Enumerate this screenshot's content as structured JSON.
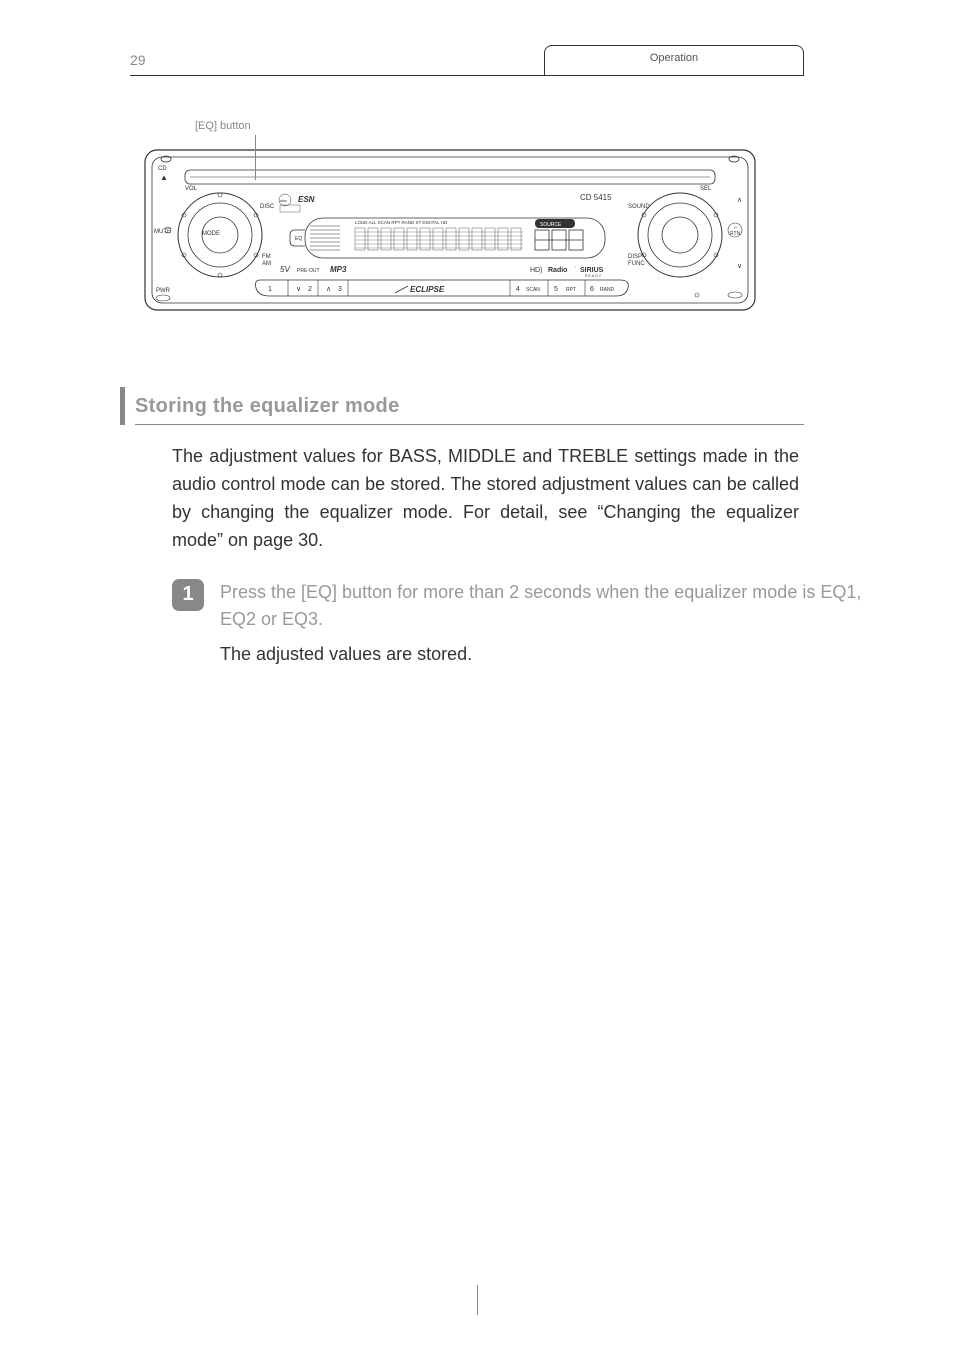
{
  "header": {
    "tab_label": "Operation",
    "page_number": "29"
  },
  "diagram": {
    "callout": "[EQ] button",
    "model": "CD 5415",
    "brand": "ECLIPSE",
    "logo": "ESN",
    "left_labels": {
      "cd": "CD",
      "vol": "VOL",
      "mode": "MODE",
      "mute": "MUTE",
      "disc": "DISC",
      "fm_am": "FM\nAM",
      "pwr": "PWR"
    },
    "right_labels": {
      "sel": "SEL",
      "sound": "SOUND",
      "disp_func": "DISP\nFUNC",
      "rtn": "RTN"
    },
    "display_indicators": "LOUD ALL SCAN RPT RAND ST DIGITAL HD",
    "source": "SOURCE",
    "eq": "EQ",
    "preout": "5V PRE-OUT",
    "mp3": "MP3",
    "hd_radio": "HD Radio",
    "sirius": "SIRIUS",
    "sirius_ready": "READY",
    "bottom_buttons": [
      "1",
      "2",
      "3",
      "4",
      "5",
      "6"
    ],
    "bottom_sub": [
      "",
      "",
      "",
      "SCAN",
      "RPT",
      "RAND"
    ],
    "arrows": {
      "down": "∨",
      "up": "∧"
    }
  },
  "section": {
    "title": "Storing the equalizer mode",
    "body": "The adjustment values for BASS, MIDDLE and TREBLE settings made in the audio control mode can be stored.  The stored adjustment values can be called by changing the equalizer mode. For detail, see “Changing the equalizer mode” on page 30."
  },
  "step": {
    "number": "1",
    "instruction": "Press the [EQ] button for more than 2 seconds when the equalizer mode is EQ1, EQ2 or EQ3.",
    "result": "The adjusted values are stored."
  }
}
